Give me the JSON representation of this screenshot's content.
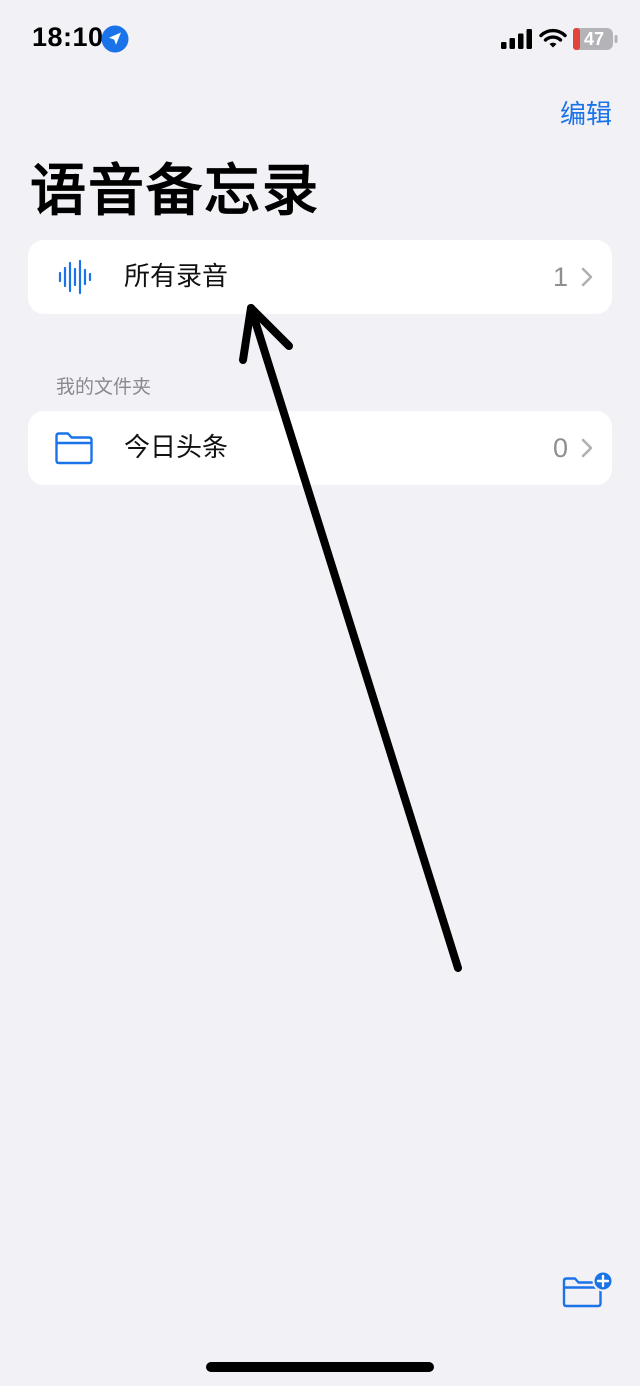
{
  "status_bar": {
    "time": "18:10",
    "battery": "47"
  },
  "nav": {
    "edit_label": "编辑"
  },
  "page": {
    "title": "语音备忘录"
  },
  "all_recordings": {
    "label": "所有录音",
    "count": "1",
    "icon": "waveform-icon"
  },
  "folders_section": {
    "header": "我的文件夹",
    "items": [
      {
        "label": "今日头条",
        "count": "0",
        "icon": "folder-icon"
      }
    ]
  },
  "toolbar": {
    "new_folder_icon": "folder-plus-icon"
  },
  "colors": {
    "accent": "#1a73e8",
    "background": "#f2f1f6",
    "card": "#ffffff",
    "secondary_text": "#8e8e93"
  }
}
